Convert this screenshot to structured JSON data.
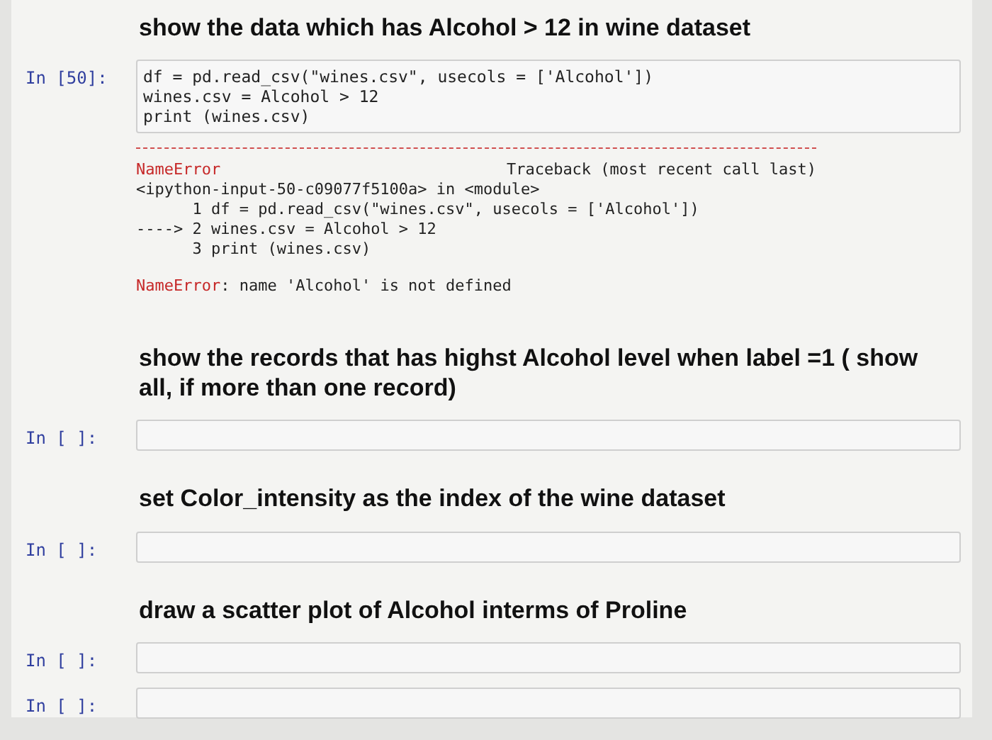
{
  "cells": [
    {
      "kind": "markdown",
      "text": "show the data which has Alcohol > 12 in wine dataset"
    },
    {
      "kind": "code",
      "prompt": "In [50]:",
      "lines": [
        "df = pd.read_csv(\"wines.csv\", usecols = ['Alcohol'])",
        "wines.csv = Alcohol > 12",
        "print (wines.csv)"
      ],
      "output": {
        "error_name": "NameError",
        "traceback_title": "Traceback (most recent call last)",
        "location": "<ipython-input-50-c09077f5100a> in <module>",
        "frames": [
          {
            "number": "1",
            "code": "df = pd.read_csv(\"wines.csv\", usecols = ['Alcohol'])"
          },
          {
            "arrow": "---->",
            "number": "2",
            "code": "wines.csv = Alcohol > 12"
          },
          {
            "number": "3",
            "code": "print (wines.csv)"
          }
        ],
        "message_name": "NameError",
        "message": ": name 'Alcohol' is not defined"
      }
    },
    {
      "kind": "markdown",
      "text": "show the records that has highst Alcohol level when label =1 ( show all, if more than one record)"
    },
    {
      "kind": "code",
      "prompt": "In [ ]:"
    },
    {
      "kind": "markdown",
      "text": "set Color_intensity as the index of the wine dataset"
    },
    {
      "kind": "code",
      "prompt": "In [ ]:"
    },
    {
      "kind": "markdown",
      "text": "draw a scatter plot of Alcohol interms of Proline"
    },
    {
      "kind": "code",
      "prompt": "In [ ]:"
    },
    {
      "kind": "code",
      "prompt": "In [ ]:"
    }
  ]
}
